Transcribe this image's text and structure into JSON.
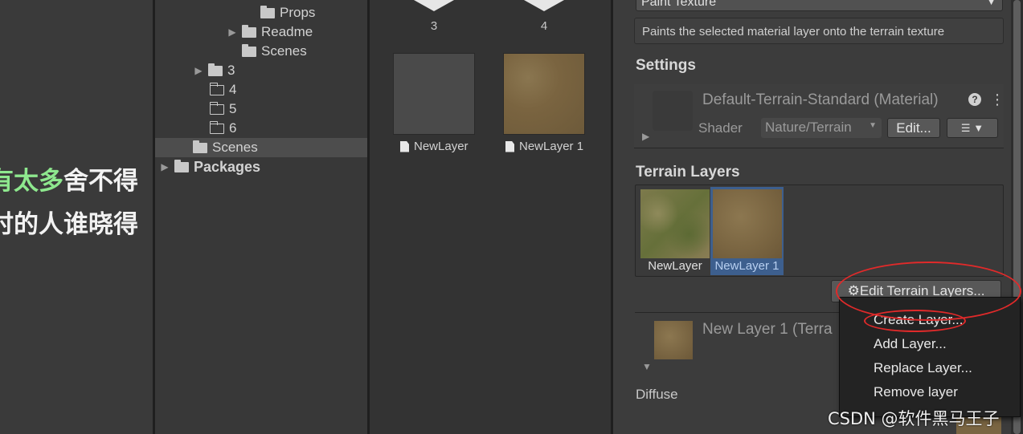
{
  "subtitles": {
    "line1_green": "有太多",
    "line1_white": "舍不得",
    "line2": "时的人谁晓得"
  },
  "tree": {
    "items": [
      {
        "label": "Props",
        "folder": "filled",
        "arrow": ""
      },
      {
        "label": "Readme",
        "folder": "filled",
        "arrow": "▶"
      },
      {
        "label": "Scenes",
        "folder": "filled",
        "arrow": ""
      },
      {
        "label": "3",
        "folder": "filled",
        "arrow": "▶"
      },
      {
        "label": "4",
        "folder": "empty",
        "arrow": ""
      },
      {
        "label": "5",
        "folder": "empty",
        "arrow": ""
      },
      {
        "label": "6",
        "folder": "empty",
        "arrow": ""
      },
      {
        "label": "Scenes",
        "folder": "filled",
        "arrow": ""
      },
      {
        "label": "Packages",
        "folder": "filled",
        "arrow": "▶"
      }
    ]
  },
  "assets": {
    "top_items": [
      {
        "label": "3"
      },
      {
        "label": "4"
      }
    ],
    "layers": [
      {
        "label": "NewLayer"
      },
      {
        "label": "NewLayer 1"
      }
    ]
  },
  "inspector": {
    "tool_dropdown": "Paint Texture",
    "tool_description": "Paints the selected material layer onto the terrain texture",
    "settings_title": "Settings",
    "material_name": "Default-Terrain-Standard (Material)",
    "shader_label": "Shader",
    "shader_value": "Nature/Terrain",
    "edit_button": "Edit...",
    "terrain_layers_title": "Terrain Layers",
    "layers": [
      {
        "label": "NewLayer",
        "selected": false
      },
      {
        "label": "NewLayer 1",
        "selected": true
      }
    ],
    "edit_layers_button": "Edit Terrain Layers...",
    "selected_layer_name": "New Layer 1 (Terra",
    "diffuse_label": "Diffuse"
  },
  "context_menu": {
    "items": [
      "Create Layer...",
      "Add Layer...",
      "Replace Layer...",
      "Remove layer"
    ]
  },
  "watermark": "CSDN @软件黑马王子",
  "colors": {
    "annotation_red": "#e02a2a",
    "selection_blue": "#3d5f8e",
    "subtitle_green": "#8ee88e"
  }
}
